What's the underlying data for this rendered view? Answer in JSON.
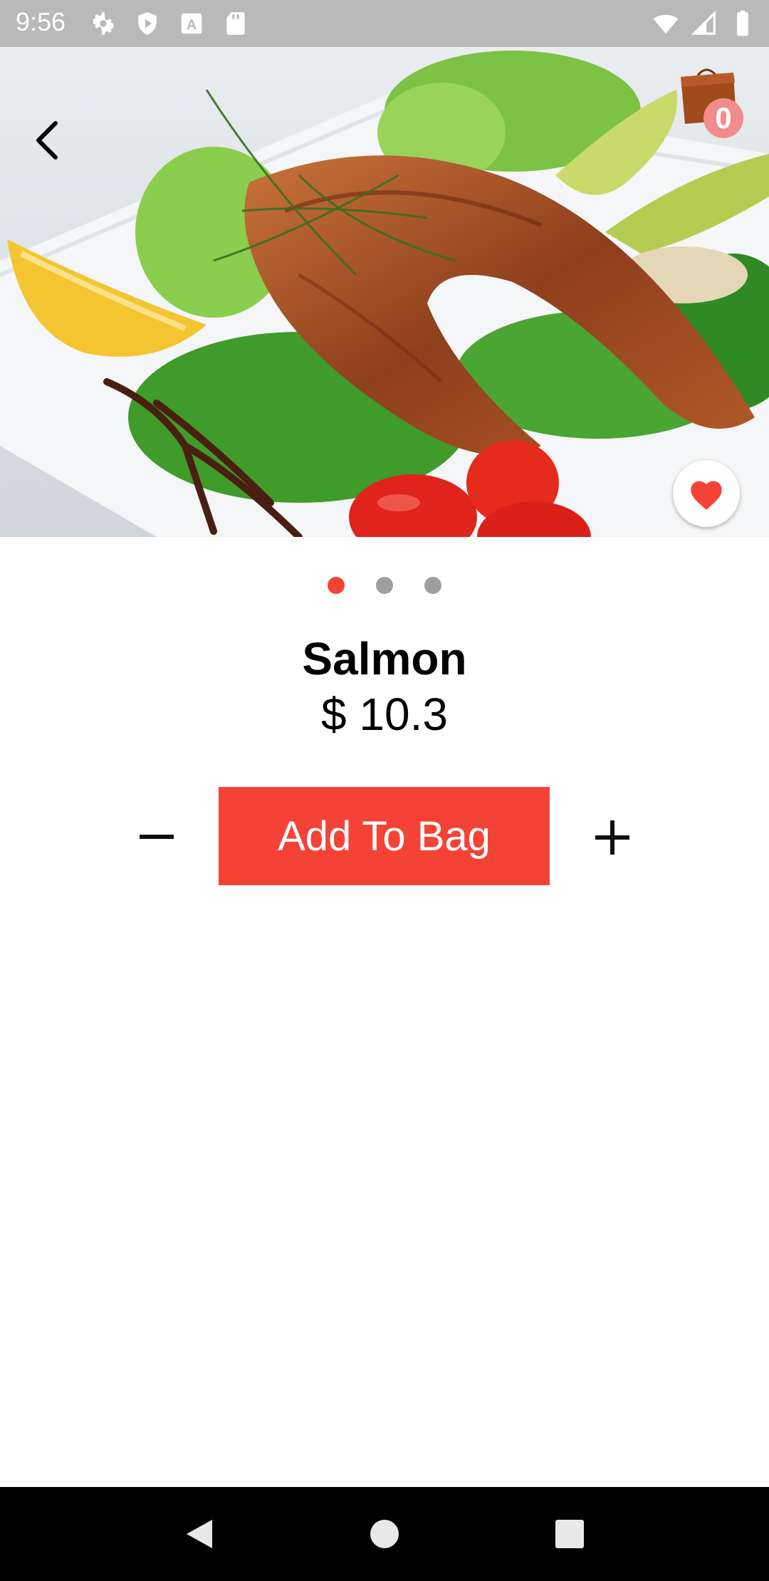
{
  "status": {
    "time": "9:56",
    "icons_left": [
      "settings-icon",
      "shield-play-icon",
      "font-a-icon",
      "sd-card-icon"
    ],
    "icons_right": [
      "wifi-icon",
      "cellular-icon",
      "battery-icon"
    ]
  },
  "header": {
    "back_icon": "chevron-left-icon",
    "bag_icon": "shopping-bag-icon",
    "bag_count": "0"
  },
  "product": {
    "image_subject": "grilled salmon plate",
    "favorite_icon": "heart-icon",
    "pager": {
      "count": 3,
      "active_index": 0
    },
    "name": "Salmon",
    "price": "$ 10.3"
  },
  "actions": {
    "minus_icon": "minus-icon",
    "add_to_bag_label": "Add To Bag",
    "plus_icon": "plus-icon"
  },
  "navigation": {
    "buttons": [
      "back-nav-icon",
      "home-nav-icon",
      "recents-nav-icon"
    ]
  },
  "colors": {
    "accent": "#f44336",
    "status_bar": "#b9b9b9",
    "dot_inactive": "#9e9e9e",
    "badge": "#f28b8b"
  }
}
